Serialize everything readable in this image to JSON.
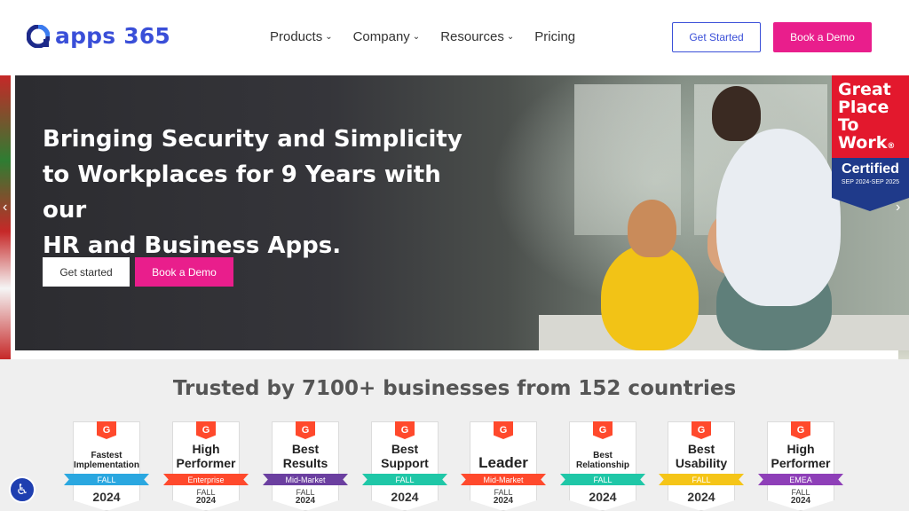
{
  "header": {
    "logo_text": "apps 365",
    "nav": [
      {
        "label": "Products",
        "has_dropdown": true
      },
      {
        "label": "Company",
        "has_dropdown": true
      },
      {
        "label": "Resources",
        "has_dropdown": true
      },
      {
        "label": "Pricing",
        "has_dropdown": false
      }
    ],
    "get_started_label": "Get Started",
    "book_demo_label": "Book a Demo"
  },
  "hero": {
    "title_line1": "Bringing Security and Simplicity",
    "title_line2": "to Workplaces for 9 Years with our",
    "title_line3": "HR and Business Apps.",
    "get_started_label": "Get started",
    "book_demo_label": "Book a Demo",
    "prev_icon": "chevron-left-icon",
    "next_icon": "chevron-right-icon"
  },
  "gptw": {
    "line1": "Great",
    "line2": "Place",
    "line3": "To",
    "line4": "Work",
    "certified": "Certified",
    "dates": "SEP 2024-SEP 2025"
  },
  "trusted_title": "Trusted by 7100+ businesses from 152 countries",
  "badges": [
    {
      "title1": "Fastest",
      "title2": "Implementation",
      "ribbon": "FALL",
      "ribbon_color": "#2aa7e0",
      "season": "",
      "year": "2024",
      "title_size": "small"
    },
    {
      "title1": "High",
      "title2": "Performer",
      "ribbon": "Enterprise",
      "ribbon_color": "#ff492c",
      "season": "FALL",
      "year": "2024",
      "title_size": "large"
    },
    {
      "title1": "Best",
      "title2": "Results",
      "ribbon": "Mid-Market",
      "ribbon_color": "#6b3fa0",
      "season": "FALL",
      "year": "2024",
      "title_size": "large"
    },
    {
      "title1": "Best",
      "title2": "Support",
      "ribbon": "FALL",
      "ribbon_color": "#1fc7a7",
      "season": "",
      "year": "2024",
      "title_size": "large"
    },
    {
      "title1": "Leader",
      "title2": "",
      "ribbon": "Mid-Market",
      "ribbon_color": "#ff492c",
      "season": "FALL",
      "year": "2024",
      "title_size": "xlarge"
    },
    {
      "title1": "Best",
      "title2": "Relationship",
      "ribbon": "FALL",
      "ribbon_color": "#1fc7a7",
      "season": "",
      "year": "2024",
      "title_size": "small"
    },
    {
      "title1": "Best",
      "title2": "Usability",
      "ribbon": "FALL",
      "ribbon_color": "#f5c518",
      "season": "",
      "year": "2024",
      "title_size": "large"
    },
    {
      "title1": "High",
      "title2": "Performer",
      "ribbon": "EMEA",
      "ribbon_color": "#8e3fb8",
      "season": "FALL",
      "year": "2024",
      "title_size": "large"
    }
  ],
  "colors": {
    "brand_blue": "#3a4fd8",
    "brand_pink": "#e91e8c",
    "g2_orange": "#ff492c"
  },
  "accessibility_icon": "accessibility-icon"
}
